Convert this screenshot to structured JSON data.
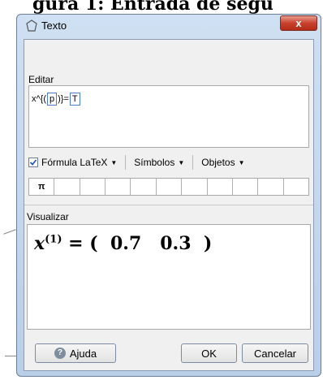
{
  "background": {
    "text": "gura 1: Entrada de segu"
  },
  "window": {
    "title": "Texto",
    "close_label": "x"
  },
  "editor": {
    "label": "Editar",
    "expression": {
      "prefix": "x^{(",
      "slot1": "p",
      "middle": ")}=",
      "slot2": "T"
    }
  },
  "toolbar": {
    "latex_label": "Fórmula LaTeX",
    "latex_checked": true,
    "symbols_label": "Símbolos",
    "objects_label": "Objetos"
  },
  "symbols": [
    "π",
    "",
    "",
    "",
    "",
    "",
    "",
    "",
    "",
    "",
    ""
  ],
  "preview": {
    "label": "Visualizar",
    "formula": {
      "var": "x",
      "sup": "(1)",
      "rest": "= (  0.7   0.3  )"
    }
  },
  "buttons": {
    "help": "Ajuda",
    "ok": "OK",
    "cancel": "Cancelar"
  }
}
